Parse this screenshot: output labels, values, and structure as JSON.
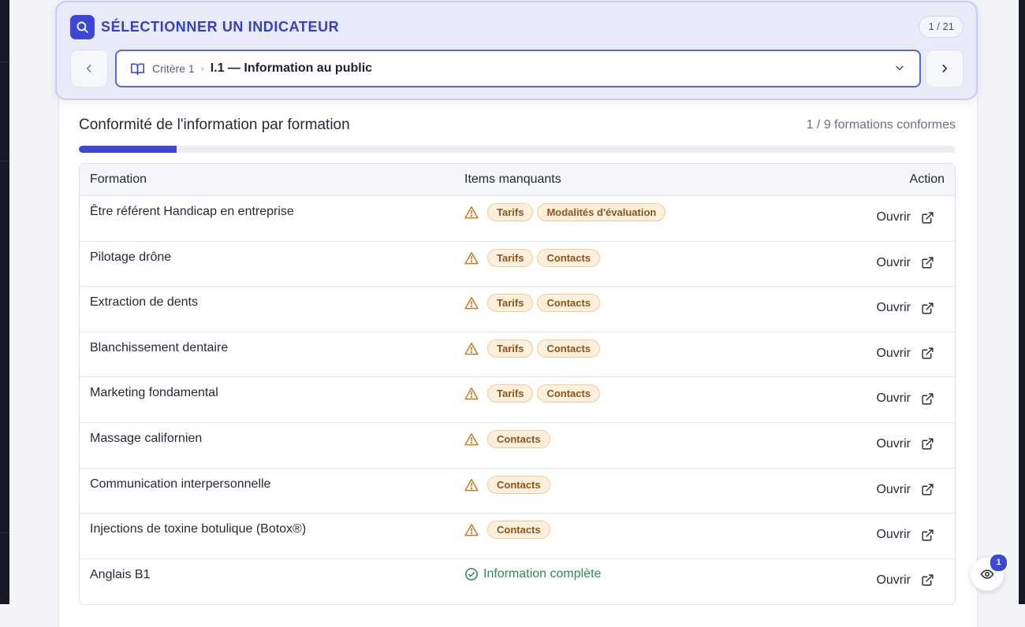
{
  "selector": {
    "title": "SÉLECTIONNER UN INDICATEUR",
    "counter": "1 / 21",
    "criterion": "Critère 1",
    "indicator": "I.1 — Information au public",
    "icons": {
      "main": "search-icon",
      "book": "book-icon",
      "prev": "chevron-left-icon",
      "next": "chevron-right-icon",
      "dropdown": "chevron-down-icon"
    }
  },
  "conformity": {
    "title": "Conformité de l'information par formation",
    "count_text": "1 / 9 formations conformes",
    "compliant": 1,
    "total": 9
  },
  "table": {
    "headers": {
      "formation": "Formation",
      "missing": "Items manquants",
      "action": "Action"
    },
    "rows": [
      {
        "formation": "Être référent Handicap en entreprise",
        "missing": [
          "Tarifs",
          "Modalités d'évaluation"
        ],
        "complete": false,
        "action": "Ouvrir"
      },
      {
        "formation": "Pilotage drône",
        "missing": [
          "Tarifs",
          "Contacts"
        ],
        "complete": false,
        "action": "Ouvrir"
      },
      {
        "formation": "Extraction de dents",
        "missing": [
          "Tarifs",
          "Contacts"
        ],
        "complete": false,
        "action": "Ouvrir"
      },
      {
        "formation": "Blanchissement dentaire",
        "missing": [
          "Tarifs",
          "Contacts"
        ],
        "complete": false,
        "action": "Ouvrir"
      },
      {
        "formation": "Marketing fondamental",
        "missing": [
          "Tarifs",
          "Contacts"
        ],
        "complete": false,
        "action": "Ouvrir"
      },
      {
        "formation": "Massage californien",
        "missing": [
          "Contacts"
        ],
        "complete": false,
        "action": "Ouvrir"
      },
      {
        "formation": "Communication interpersonnelle",
        "missing": [
          "Contacts"
        ],
        "complete": false,
        "action": "Ouvrir"
      },
      {
        "formation": "Injections de toxine botulique (Botox®)",
        "missing": [
          "Contacts"
        ],
        "complete": false,
        "action": "Ouvrir"
      },
      {
        "formation": "Anglais B1",
        "missing": [],
        "complete": true,
        "complete_text": "Information complète",
        "action": "Ouvrir"
      }
    ]
  },
  "fab": {
    "badge": "1",
    "icon": "eye-icon"
  },
  "colors": {
    "accent": "#3b47d6",
    "warning": "#c77a1e",
    "tag_bg": "#fcf0dc",
    "success": "#2c8a55"
  }
}
